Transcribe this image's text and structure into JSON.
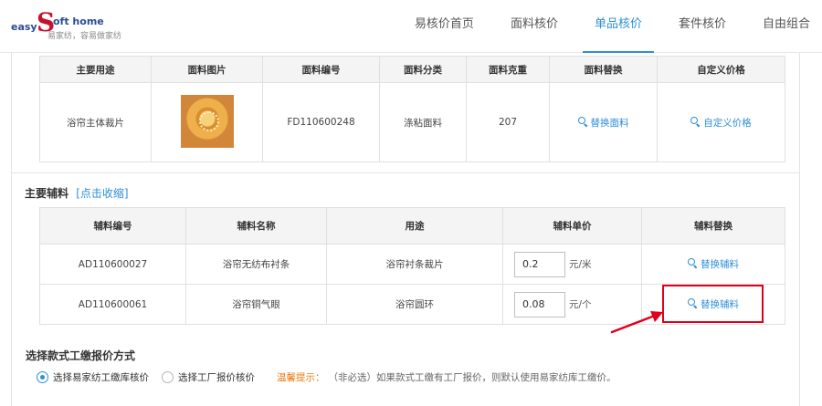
{
  "brand": {
    "easy": "easy",
    "big_s": "S",
    "oft": "oft home",
    "slogan": "易家纺，容易做家纺"
  },
  "nav": [
    {
      "label": "易核价首页",
      "active": false
    },
    {
      "label": "面料核价",
      "active": false
    },
    {
      "label": "单品核价",
      "active": true
    },
    {
      "label": "套件核价",
      "active": false
    },
    {
      "label": "自由组合",
      "active": false
    }
  ],
  "fabric_table": {
    "headers": [
      "主要用途",
      "面料图片",
      "面料编号",
      "面料分类",
      "面料克重",
      "面料替换",
      "自定义价格"
    ],
    "row": {
      "usage": "浴帘主体裁片",
      "image_icon": "fabric-swatch-image",
      "code": "FD110600248",
      "category": "涤粘面料",
      "weight": "207",
      "replace_label": "替换面料",
      "custom_price_label": "自定义价格"
    }
  },
  "aux_section": {
    "title": "主要辅料",
    "toggle": "[点击收缩]"
  },
  "aux_table": {
    "headers": [
      "辅料编号",
      "辅料名称",
      "用途",
      "辅料单价",
      "辅料替换"
    ],
    "rows": [
      {
        "code": "AD110600027",
        "name": "浴帘无纺布衬条",
        "usage": "浴帘衬条裁片",
        "price": "0.2",
        "unit": "元/米",
        "replace_label": "替换辅料"
      },
      {
        "code": "AD110600061",
        "name": "浴帘铜气眼",
        "usage": "浴帘圆环",
        "price": "0.08",
        "unit": "元/个",
        "replace_label": "替换辅料"
      }
    ]
  },
  "labor_section": {
    "title": "选择款式工缴报价方式",
    "option_library": "选择易家纺工缴库核价",
    "option_factory": "选择工厂报价核价",
    "selected": "option_library",
    "tip_label": "温馨提示：",
    "tip_text": "（非必选）如果款式工缴有工厂报价，则默认使用易家纺库工缴价。"
  },
  "icons": {
    "search": "search-icon",
    "arrow": "red-arrow-annotation"
  },
  "colors": {
    "accent": "#2e8fd6",
    "annotation": "#e0001b",
    "tip": "#e8790e",
    "brand_red": "#c8102e",
    "brand_blue": "#2a4d8f"
  }
}
